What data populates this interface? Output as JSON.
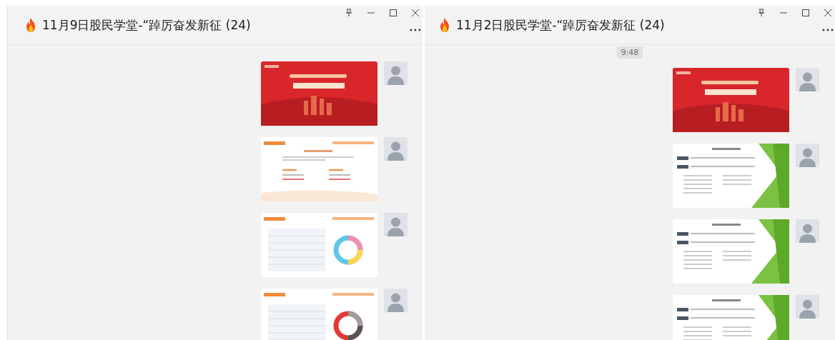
{
  "windows": [
    {
      "title": "11月9日股民学堂-“踔厉奋发新征 (24)",
      "messages": [
        {
          "kind": "red-cover"
        },
        {
          "kind": "orange-slide"
        },
        {
          "kind": "donut-slide"
        },
        {
          "kind": "donut-table-slide"
        }
      ]
    },
    {
      "title": "11月2日股民学堂-“踔厉奋发新征 (24)",
      "timestamp": "9:48",
      "messages": [
        {
          "kind": "red-cover"
        },
        {
          "kind": "green-slide"
        },
        {
          "kind": "green-slide"
        },
        {
          "kind": "green-slide"
        }
      ]
    }
  ]
}
